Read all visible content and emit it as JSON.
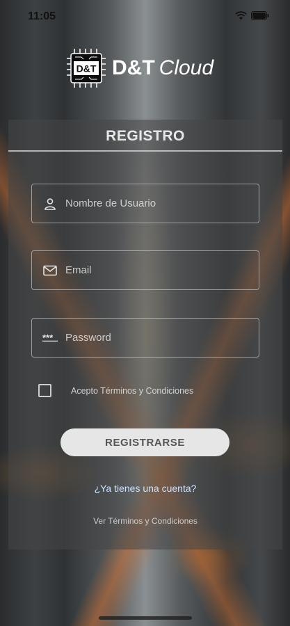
{
  "status_bar": {
    "time": "11:05",
    "icons": [
      "wifi-icon",
      "battery-icon"
    ]
  },
  "logo": {
    "chip_text": "D&T",
    "brand_bold": "D&T",
    "brand_light": "Cloud"
  },
  "form": {
    "title": "REGISTRO",
    "fields": [
      {
        "name": "username",
        "icon": "user-icon",
        "value": "",
        "placeholder": "Nombre de Usuario"
      },
      {
        "name": "email",
        "icon": "mail-icon",
        "value": "",
        "placeholder": "Email"
      },
      {
        "name": "password",
        "icon": "password-dots-icon",
        "value": "",
        "placeholder": "Password"
      }
    ],
    "terms_checkbox": {
      "label": "Acepto Términos y Condiciones",
      "checked": false
    },
    "submit_label": "REGISTRARSE",
    "login_link": "¿Ya tienes una cuenta?",
    "terms_link": "Ver Términos y Condiciones"
  },
  "colors": {
    "card_bg": "#464646",
    "button_bg": "#e6e6e6",
    "link": "#cde3ff"
  }
}
